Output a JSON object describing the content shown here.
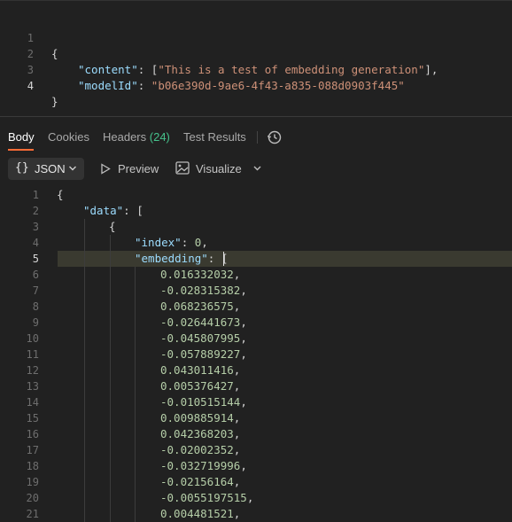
{
  "request": {
    "line_numbers": [
      "1",
      "2",
      "3",
      "4"
    ],
    "open_brace": "{",
    "content_key": "\"content\"",
    "colon": ":",
    "bracket_open": "[",
    "content_value": "\"This is a test of embedding generation\"",
    "bracket_close_comma": "],",
    "model_key": "\"modelId\"",
    "model_value": "\"b06e390d-9ae6-4f43-a835-088d0903f445\"",
    "close_brace": "}"
  },
  "tabs": {
    "body": "Body",
    "cookies": "Cookies",
    "headers": "Headers",
    "headers_count": "(24)",
    "test_results": "Test Results"
  },
  "toolbar": {
    "format_braces": "{}",
    "format_label": "JSON",
    "preview": "Preview",
    "visualize": "Visualize"
  },
  "response": {
    "line_numbers": [
      "1",
      "2",
      "3",
      "4",
      "5",
      "6",
      "7",
      "8",
      "9",
      "10",
      "11",
      "12",
      "13",
      "14",
      "15",
      "16",
      "17",
      "18",
      "19",
      "20",
      "21"
    ],
    "open_brace": "{",
    "data_key": "\"data\"",
    "colon": ":",
    "bracket_open": "[",
    "obj_open": "{",
    "index_key": "\"index\"",
    "index_value": "0",
    "comma": ",",
    "embedding_key": "\"embedding\"",
    "embedding_open": "[",
    "values": [
      "0.016332032",
      "-0.028315382",
      "0.068236575",
      "-0.026441673",
      "-0.045807995",
      "-0.057889227",
      "0.043011416",
      "0.005376427",
      "-0.010515144",
      "0.009885914",
      "0.042368203",
      "-0.02002352",
      "-0.032719996",
      "-0.02156164",
      "-0.0055197515",
      "0.004481521"
    ]
  },
  "colors": {
    "accent": "#ff6c37",
    "key": "#9cdcfe",
    "string": "#ce9178",
    "number": "#b5cea8",
    "count": "#46c28c"
  }
}
